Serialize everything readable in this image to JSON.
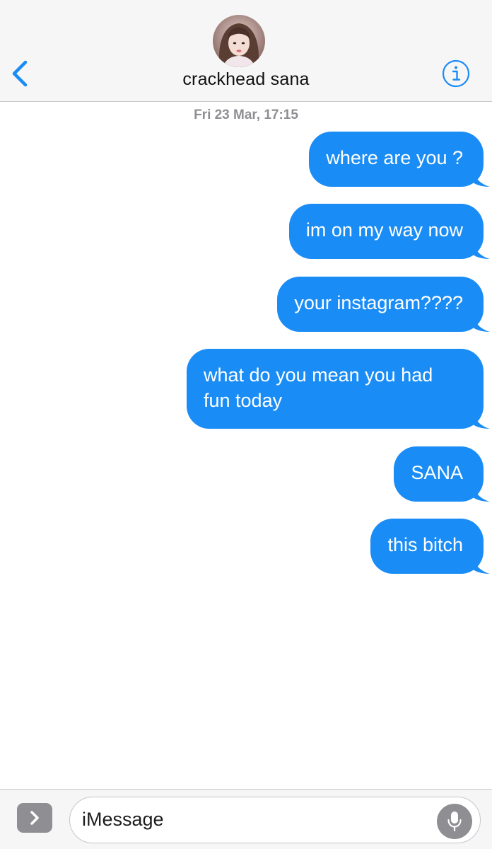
{
  "header": {
    "contact_name": "crackhead sana"
  },
  "conversation": {
    "timestamp": "Fri 23 Mar, 17:15",
    "messages": [
      {
        "direction": "sent",
        "text": "where are you ?"
      },
      {
        "direction": "sent",
        "text": "im on my way now"
      },
      {
        "direction": "sent",
        "text": "your instagram????"
      },
      {
        "direction": "sent",
        "text": "what do you mean you had fun today"
      },
      {
        "direction": "sent",
        "text": "SANA"
      },
      {
        "direction": "sent",
        "text": "this bitch"
      }
    ]
  },
  "input_bar": {
    "placeholder": "iMessage"
  },
  "colors": {
    "accent": "#1a8cf5",
    "header_bg": "#f6f6f7",
    "timestamp": "#8e8e93",
    "icon_gray": "#8e8e93"
  },
  "icons": {
    "back": "chevron-left-icon",
    "info": "info-icon",
    "apps": "chevron-right-icon",
    "mic": "microphone-icon"
  }
}
